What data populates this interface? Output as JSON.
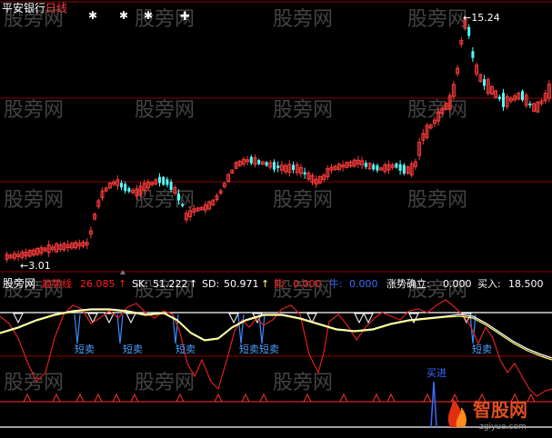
{
  "window": {
    "stock_name": "平安银行",
    "period": "日线"
  },
  "watermark": {
    "text": "股旁网"
  },
  "main_chart": {
    "high_label": "←15.24",
    "low_label": "←3.01",
    "up_color": "#ff3c3c",
    "down_color": "#54fcfc",
    "grid_color": "#8b0000"
  },
  "indicator": {
    "site_label": "股旁网",
    "line_name": "趋势线",
    "line_value": "26.085",
    "line_arrow": "↑",
    "sk_label": "SK:",
    "sk_value": "51.222",
    "sk_arrow": "↑",
    "sd_label": "SD:",
    "sd_value": "50.971",
    "sd_arrow": "↑",
    "xiong_label": "熊:",
    "xiong_value": "0.000",
    "niu_label": "牛:",
    "niu_value": "0.000",
    "trend_label": "涨势确立:",
    "trend_value": "0.000",
    "buy_label": "买入:",
    "buy_value": "18.500",
    "short_sell_label": "短卖",
    "short_sell_pair_label": "短卖短卖",
    "buy_signal_label": "买进"
  },
  "logo": {
    "name": "智股网",
    "url": "zgiyue.com"
  }
}
